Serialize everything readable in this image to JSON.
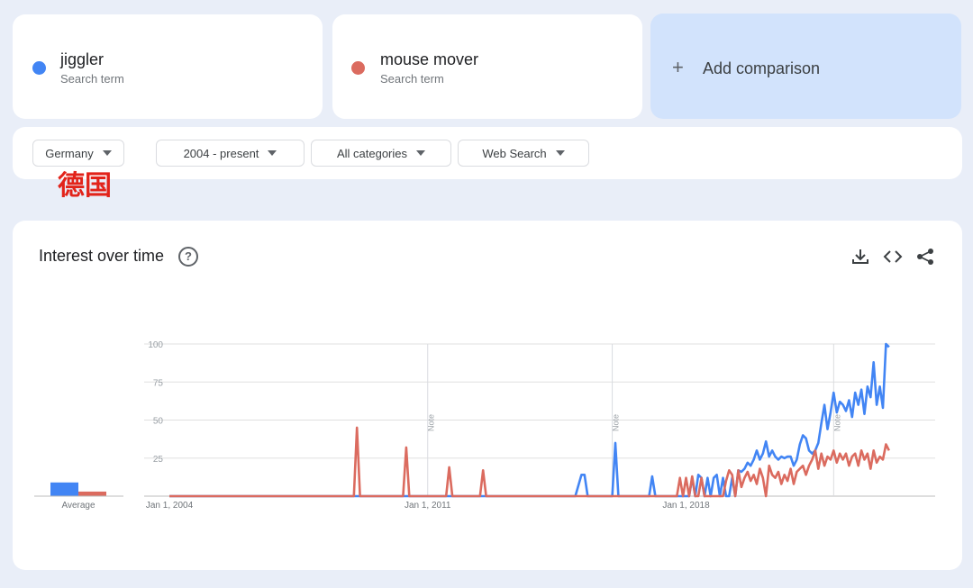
{
  "terms": [
    {
      "name": "jiggler",
      "subtitle": "Search term",
      "color": "#4285f4"
    },
    {
      "name": "mouse mover",
      "subtitle": "Search term",
      "color": "#db6b5f"
    }
  ],
  "add_comparison": {
    "label": "Add comparison"
  },
  "filters": {
    "region": "Germany",
    "time_range": "2004 - present",
    "category": "All categories",
    "search_type": "Web Search"
  },
  "overlay_annotation": "德国",
  "panel": {
    "title": "Interest over time"
  },
  "toolbar": {
    "icons": [
      "download-icon",
      "embed-icon",
      "share-icon"
    ]
  },
  "chart_data": {
    "type": "line",
    "ylim": [
      0,
      100
    ],
    "y_ticks": [
      "100",
      "75",
      "50",
      "25"
    ],
    "x_tick_labels": [
      "Jan 1, 2004",
      "Jan 1, 2011",
      "Jan 1, 2018"
    ],
    "x_range": [
      "2004-01",
      "2024-10"
    ],
    "notes": [
      {
        "date": "2011-01",
        "label": "Note"
      },
      {
        "date": "2016-01",
        "label": "Note"
      },
      {
        "date": "2022-01",
        "label": "Note"
      }
    ],
    "average": {
      "label": "Average",
      "values": [
        9,
        3
      ]
    },
    "series": [
      {
        "name": "jiggler",
        "color": "#4285f4",
        "points": [
          [
            "2004-01",
            0
          ],
          [
            "2015-01",
            0
          ],
          [
            "2015-03",
            14
          ],
          [
            "2015-04",
            14
          ],
          [
            "2015-05",
            0
          ],
          [
            "2016-01",
            0
          ],
          [
            "2016-02",
            35
          ],
          [
            "2016-03",
            0
          ],
          [
            "2017-01",
            0
          ],
          [
            "2017-02",
            13
          ],
          [
            "2017-03",
            0
          ],
          [
            "2018-02",
            0
          ],
          [
            "2018-03",
            12
          ],
          [
            "2018-04",
            0
          ],
          [
            "2018-05",
            14
          ],
          [
            "2018-06",
            12
          ],
          [
            "2018-07",
            0
          ],
          [
            "2018-08",
            12
          ],
          [
            "2018-09",
            0
          ],
          [
            "2018-10",
            12
          ],
          [
            "2018-11",
            14
          ],
          [
            "2018-12",
            0
          ],
          [
            "2019-01",
            12
          ],
          [
            "2019-02",
            0
          ],
          [
            "2019-03",
            0
          ],
          [
            "2019-04",
            12
          ],
          [
            "2019-05",
            0
          ],
          [
            "2019-06",
            17
          ],
          [
            "2019-07",
            16
          ],
          [
            "2019-08",
            18
          ],
          [
            "2019-09",
            22
          ],
          [
            "2019-10",
            20
          ],
          [
            "2019-11",
            24
          ],
          [
            "2019-12",
            30
          ],
          [
            "2020-01",
            24
          ],
          [
            "2020-02",
            28
          ],
          [
            "2020-03",
            36
          ],
          [
            "2020-04",
            26
          ],
          [
            "2020-05",
            30
          ],
          [
            "2020-06",
            26
          ],
          [
            "2020-07",
            24
          ],
          [
            "2020-08",
            26
          ],
          [
            "2020-09",
            25
          ],
          [
            "2020-10",
            26
          ],
          [
            "2020-11",
            26
          ],
          [
            "2020-12",
            20
          ],
          [
            "2021-01",
            24
          ],
          [
            "2021-02",
            34
          ],
          [
            "2021-03",
            40
          ],
          [
            "2021-04",
            38
          ],
          [
            "2021-05",
            30
          ],
          [
            "2021-06",
            28
          ],
          [
            "2021-07",
            30
          ],
          [
            "2021-08",
            35
          ],
          [
            "2021-09",
            48
          ],
          [
            "2021-10",
            60
          ],
          [
            "2021-11",
            44
          ],
          [
            "2021-12",
            55
          ],
          [
            "2022-01",
            68
          ],
          [
            "2022-02",
            55
          ],
          [
            "2022-03",
            62
          ],
          [
            "2022-04",
            60
          ],
          [
            "2022-05",
            56
          ],
          [
            "2022-06",
            63
          ],
          [
            "2022-07",
            52
          ],
          [
            "2022-08",
            68
          ],
          [
            "2022-09",
            60
          ],
          [
            "2022-10",
            70
          ],
          [
            "2022-11",
            54
          ],
          [
            "2022-12",
            72
          ],
          [
            "2023-01",
            65
          ],
          [
            "2023-02",
            88
          ],
          [
            "2023-03",
            60
          ],
          [
            "2023-04",
            72
          ],
          [
            "2023-05",
            58
          ],
          [
            "2023-06",
            100
          ],
          [
            "2023-07",
            98
          ]
        ]
      },
      {
        "name": "mouse mover",
        "color": "#db6b5f",
        "points": [
          [
            "2004-01",
            0
          ],
          [
            "2009-01",
            0
          ],
          [
            "2009-02",
            45
          ],
          [
            "2009-03",
            0
          ],
          [
            "2010-05",
            0
          ],
          [
            "2010-06",
            32
          ],
          [
            "2010-07",
            0
          ],
          [
            "2011-07",
            0
          ],
          [
            "2011-08",
            19
          ],
          [
            "2011-09",
            0
          ],
          [
            "2012-06",
            0
          ],
          [
            "2012-07",
            17
          ],
          [
            "2012-08",
            0
          ],
          [
            "2017-10",
            0
          ],
          [
            "2017-11",
            12
          ],
          [
            "2017-12",
            0
          ],
          [
            "2018-01",
            12
          ],
          [
            "2018-02",
            0
          ],
          [
            "2018-03",
            13
          ],
          [
            "2018-04",
            0
          ],
          [
            "2018-05",
            0
          ],
          [
            "2018-06",
            12
          ],
          [
            "2018-07",
            0
          ],
          [
            "2019-01",
            0
          ],
          [
            "2019-02",
            10
          ],
          [
            "2019-03",
            17
          ],
          [
            "2019-04",
            14
          ],
          [
            "2019-05",
            0
          ],
          [
            "2019-06",
            17
          ],
          [
            "2019-07",
            6
          ],
          [
            "2019-08",
            12
          ],
          [
            "2019-09",
            16
          ],
          [
            "2019-10",
            10
          ],
          [
            "2019-11",
            14
          ],
          [
            "2019-12",
            8
          ],
          [
            "2020-01",
            18
          ],
          [
            "2020-02",
            12
          ],
          [
            "2020-03",
            0
          ],
          [
            "2020-04",
            20
          ],
          [
            "2020-05",
            14
          ],
          [
            "2020-06",
            12
          ],
          [
            "2020-07",
            16
          ],
          [
            "2020-08",
            8
          ],
          [
            "2020-09",
            14
          ],
          [
            "2020-10",
            10
          ],
          [
            "2020-11",
            18
          ],
          [
            "2020-12",
            8
          ],
          [
            "2021-01",
            16
          ],
          [
            "2021-02",
            18
          ],
          [
            "2021-03",
            20
          ],
          [
            "2021-04",
            14
          ],
          [
            "2021-05",
            20
          ],
          [
            "2021-06",
            24
          ],
          [
            "2021-07",
            30
          ],
          [
            "2021-08",
            18
          ],
          [
            "2021-09",
            28
          ],
          [
            "2021-10",
            20
          ],
          [
            "2021-11",
            26
          ],
          [
            "2021-12",
            24
          ],
          [
            "2022-01",
            30
          ],
          [
            "2022-02",
            22
          ],
          [
            "2022-03",
            28
          ],
          [
            "2022-04",
            24
          ],
          [
            "2022-05",
            28
          ],
          [
            "2022-06",
            20
          ],
          [
            "2022-07",
            26
          ],
          [
            "2022-08",
            28
          ],
          [
            "2022-09",
            20
          ],
          [
            "2022-10",
            30
          ],
          [
            "2022-11",
            24
          ],
          [
            "2022-12",
            28
          ],
          [
            "2023-01",
            18
          ],
          [
            "2023-02",
            30
          ],
          [
            "2023-03",
            22
          ],
          [
            "2023-04",
            26
          ],
          [
            "2023-05",
            24
          ],
          [
            "2023-06",
            34
          ],
          [
            "2023-07",
            30
          ]
        ]
      }
    ]
  }
}
